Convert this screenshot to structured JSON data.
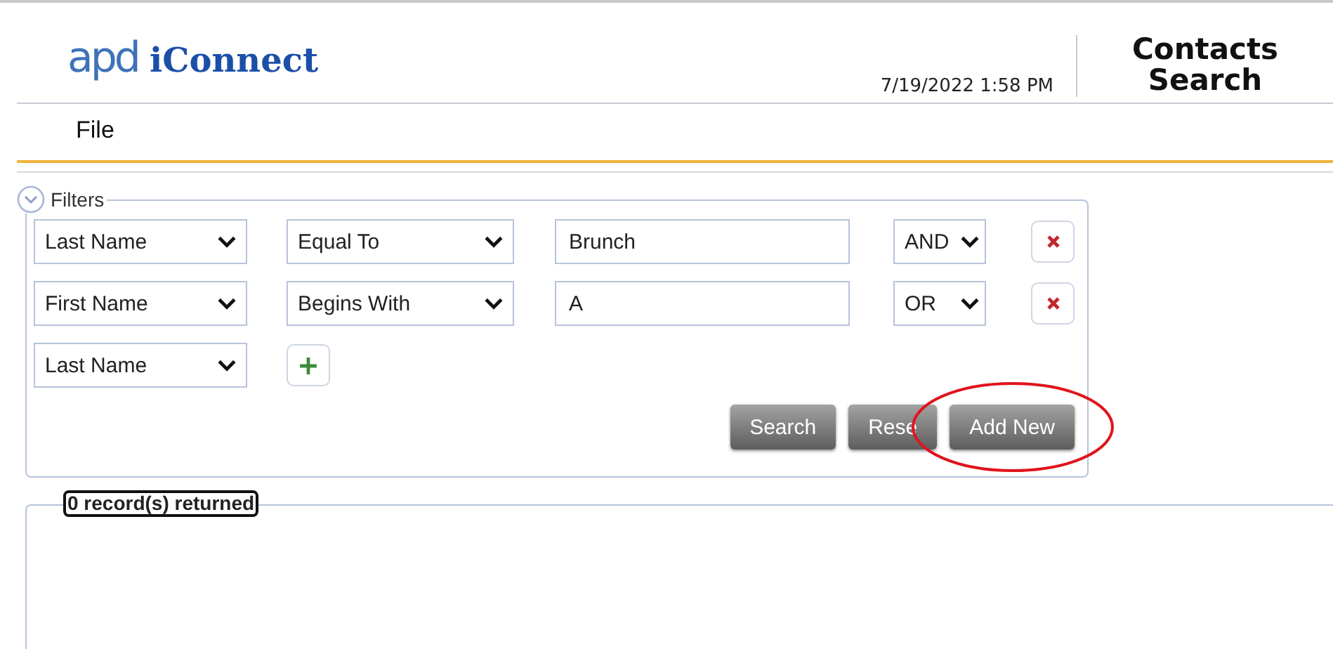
{
  "header": {
    "logo_mark": "apd",
    "logo_name": "iConnect",
    "datetime": "7/19/2022 1:58 PM",
    "title_lines": [
      "Contacts",
      "Search"
    ]
  },
  "menu": [
    "File"
  ],
  "filters": {
    "legend": "Filters",
    "expanded": true,
    "rows": [
      {
        "field": "Last Name",
        "operator": "Equal To",
        "value": "Brunch",
        "join": "AND"
      },
      {
        "field": "First Name",
        "operator": "Begins With",
        "value": "A",
        "join": "OR"
      }
    ],
    "new_field": "Last Name",
    "buttons": [
      {
        "label": "Search",
        "highlighted": false
      },
      {
        "label": "Rese",
        "highlighted": false
      },
      {
        "label": "Add New",
        "highlighted": true
      }
    ]
  },
  "results": {
    "legend": "0 record(s) returned"
  }
}
